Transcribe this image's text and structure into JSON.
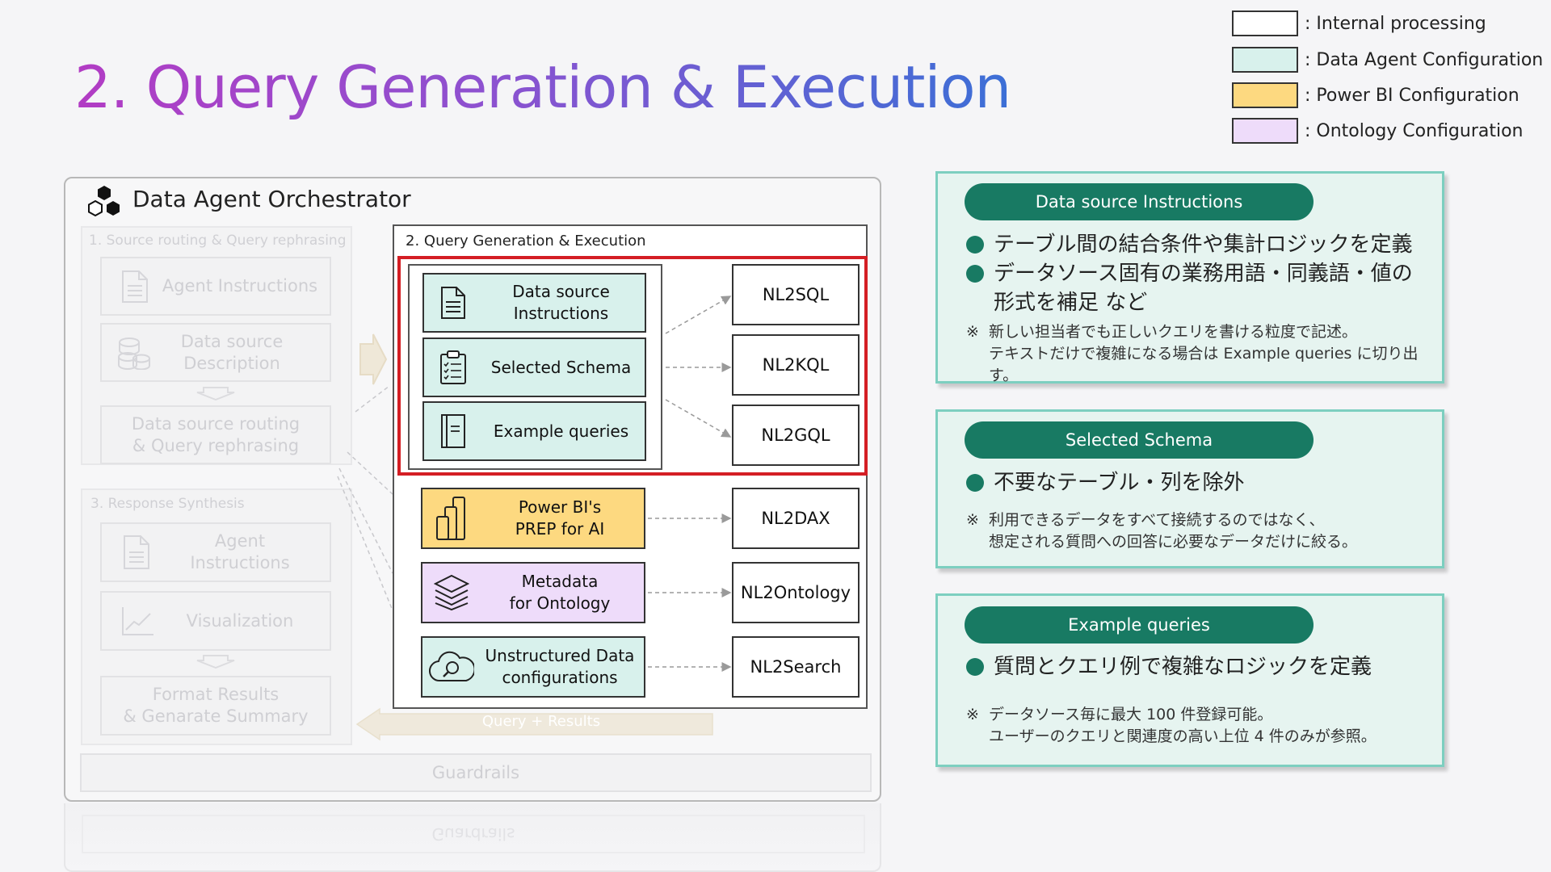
{
  "page": {
    "title": "2. Query Generation & Execution"
  },
  "legend": [
    {
      "label": ": Internal processing",
      "color": "#ffffff"
    },
    {
      "label": ": Data Agent Configuration",
      "color": "#d8f1ec"
    },
    {
      "label": ": Power BI Configuration",
      "color": "#fdd980"
    },
    {
      "label": ": Ontology Configuration",
      "color": "#eedcfa"
    }
  ],
  "orchestrator": {
    "title": "Data Agent Orchestrator",
    "section1": {
      "label": "1. Source routing & Query rephrasing",
      "agent_instructions": "Agent Instructions",
      "data_source_description": "Data source\nDescription",
      "routing": "Data source routing\n& Query rephrasing"
    },
    "section3": {
      "label": "3. Response Synthesis",
      "agent_instructions": "Agent\nInstructions",
      "visualization": "Visualization",
      "format_results": "Format Results\n& Genarate Summary"
    },
    "query_results": "Query + Results",
    "guardrails": "Guardrails"
  },
  "query_panel": {
    "title": "2. Query Generation & Execution",
    "configs": {
      "data_source_instructions": "Data source\nInstructions",
      "selected_schema": "Selected Schema",
      "example_queries": "Example queries",
      "power_bi": "Power BI's\nPREP for AI",
      "ontology": "Metadata\nfor Ontology",
      "unstructured": "Unstructured Data\nconfigurations"
    },
    "targets": {
      "nl2sql": "NL2SQL",
      "nl2kql": "NL2KQL",
      "nl2gql": "NL2GQL",
      "nl2dax": "NL2DAX",
      "nl2ontology": "NL2Ontology",
      "nl2search": "NL2Search"
    }
  },
  "cards": [
    {
      "heading": "Data source Instructions",
      "bullets": [
        "テーブル間の結合条件や集計ロジックを定義",
        "データソース固有の業務用語・同義語・値の\n形式を補足 など"
      ],
      "notes": [
        "新しい担当者でも正しいクエリを書ける粒度で記述。",
        "テキストだけで複雑になる場合は Example queries に切り出す。"
      ]
    },
    {
      "heading": "Selected Schema",
      "bullets": [
        "不要なテーブル・列を除外"
      ],
      "notes": [
        "利用できるデータをすべて接続するのではなく、",
        "想定される質問への回答に必要なデータだけに絞る。"
      ]
    },
    {
      "heading": "Example queries",
      "bullets": [
        "質問とクエリ例で複雑なロジックを定義"
      ],
      "notes": [
        "データソース毎に最大 100 件登録可能。",
        "ユーザーのクエリと関連度の高い上位 4 件のみが参照。"
      ]
    }
  ],
  "note_mark": "※"
}
